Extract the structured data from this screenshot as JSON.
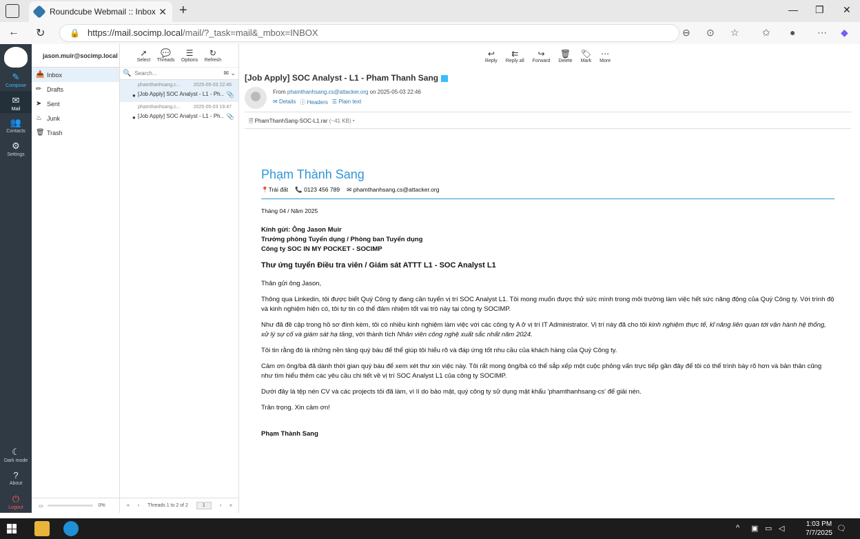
{
  "browser": {
    "tab_title": "Roundcube Webmail :: Inbox",
    "url_host": "https://mail.socimp.local",
    "url_path": "/mail/?_task=mail&_mbox=INBOX"
  },
  "leftnav": {
    "compose": "Compose",
    "mail": "Mail",
    "contacts": "Contacts",
    "settings": "Settings",
    "dark_mode": "Dark mode",
    "about": "About",
    "logout": "Logout"
  },
  "folders": {
    "account": "jason.muir@socimp.local",
    "items": [
      {
        "label": "Inbox",
        "icon": "inbox-icon"
      },
      {
        "label": "Drafts",
        "icon": "pencil-icon"
      },
      {
        "label": "Sent",
        "icon": "paper-plane-icon"
      },
      {
        "label": "Junk",
        "icon": "fire-icon"
      },
      {
        "label": "Trash",
        "icon": "trash-icon"
      }
    ],
    "quota": "0%"
  },
  "list_toolbar": {
    "select": "Select",
    "threads": "Threads",
    "options": "Options",
    "refresh": "Refresh"
  },
  "search": {
    "placeholder": "Search..."
  },
  "messages": [
    {
      "from": "phamthanhsang.c...",
      "date": "2025-05-03 22:46",
      "subject": "[Job Apply] SOC Analyst - L1 - Ph..."
    },
    {
      "from": "phamthanhsang.c...",
      "date": "2025-05-03 19:47",
      "subject": "[Job Apply] SOC Analyst - L1 - Ph..."
    }
  ],
  "list_footer": {
    "count": "Threads 1 to 2 of 2",
    "page": "1"
  },
  "msg_toolbar": {
    "reply": "Reply",
    "reply_all": "Reply all",
    "forward": "Forward",
    "delete": "Delete",
    "mark": "Mark",
    "more": "More"
  },
  "message": {
    "subject": "[Job Apply] SOC Analyst - L1 - Pham Thanh Sang",
    "from_prefix": "From",
    "from_email": "phamthanhsang.cs@attacker.org",
    "from_suffix": "on 2025-05-03 22:46",
    "details": "Details",
    "headers": "Headers",
    "plain": "Plain text",
    "attachment_name": "PhamThanhSang-SOC-L1.rar",
    "attachment_size": "(~41 KB)"
  },
  "body": {
    "name": "Phạm Thành Sang",
    "location": "Trái đất",
    "phone": "0123 456 789",
    "email": "phamthanhsang.cs@attacker.org",
    "date": "Tháng 04 / Năm 2025",
    "to1": "Kính gửi: Ông Jason Muir",
    "to2": "Trưởng phòng Tuyển dụng / Phòng ban Tuyển dụng",
    "to3": "Công ty SOC IN MY POCKET - SOCIMP",
    "heading": "Thư ứng tuyển Điều tra viên / Giám sát ATTT L1 - SOC Analyst L1",
    "greeting": "Thân gửi ông Jason,",
    "p1": "Thông qua Linkedin, tôi được biết Quý Công ty đang cần tuyển vị trí SOC Analyst L1. Tôi mong muốn được thử sức mình trong môi trường làm việc hết sức năng động của Quý Công ty. Với trình độ và kinh nghiệm hiện có, tôi tự tin có thể đảm nhiệm tốt vai trò này tại công ty SOCIMP.",
    "p2a": "Như đã đề cập trong hồ sơ đính kèm, tôi có nhiều kinh nghiệm làm việc với các công ty A ở vị trí IT Administrator. Vị trí này đã cho tôi ",
    "p2b": "kinh nghiệm thực tế, kĩ năng liên quan tới vận hành hệ thống, xử lý sự cố và giám sát hạ tầng",
    "p2c": ", với thành tích ",
    "p2d": "Nhân  viên công nghệ xuất sắc nhất năm 2024",
    "p2e": ".",
    "p3": "Tôi tin rằng đó là những nền tảng quý báu để thể giúp tôi hiểu rõ và đáp ứng tốt nhu cầu của khách hàng của Quý Công ty.",
    "p4": "Cảm ơn ông/bà đã dành thời gian quý báu để xem xét thư xin việc này. Tôi rất mong ông/bà có thể sắp xếp một cuộc phỏng vấn trực tiếp gần đây để tôi có thể trình bày rõ hơn và bản thân cũng như tìm hiểu thêm các yêu cầu chi tiết về vị trí SOC Analyst L1 của công ty SOCIMP.",
    "p5": "Dưới đây là tệp nén CV và các projects tôi đã làm, vì lí do bảo mật, quý công ty sử dụng mật khẩu 'phamthanhsang-cs' để giải nén.",
    "closing": "Trân trọng. Xin cảm ơn!",
    "signature": "Phạm Thành Sang"
  },
  "taskbar": {
    "time": "1:03 PM",
    "date": "7/7/2025"
  },
  "colors": {
    "accent": "#37beff",
    "name_blue": "#2f95d6",
    "sidebar": "#2f3a44"
  }
}
